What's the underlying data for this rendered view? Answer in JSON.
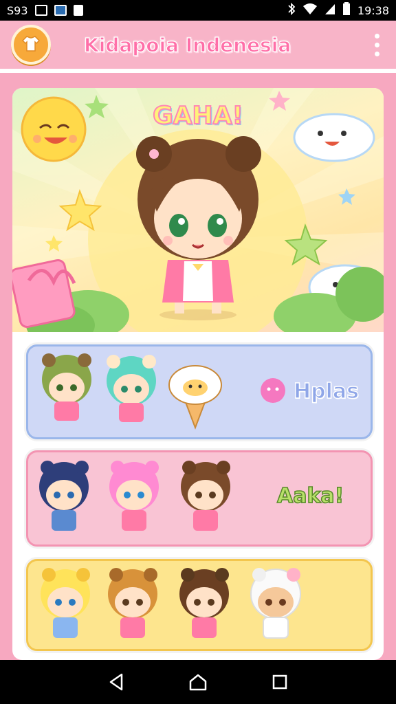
{
  "status_bar": {
    "left_text": "S93",
    "time": "19:38"
  },
  "app_bar": {
    "title": "Kidapoia Indenesia",
    "logo_icon": "shirt-icon",
    "menu_icon": "more-vert-icon"
  },
  "hero": {
    "title": "GAHA!"
  },
  "cards": [
    {
      "label": "Hplas",
      "color": "#cfd8f6",
      "label_color": "#8fa6e8"
    },
    {
      "label": "Aaka!",
      "color": "#f9c4d4",
      "label_color": "#b8e06a"
    },
    {
      "label": "",
      "color": "#fde58e"
    }
  ],
  "nav": {
    "back_icon": "back-triangle-icon",
    "home_icon": "home-icon",
    "recents_icon": "recents-square-icon"
  },
  "colors": {
    "primary_pink": "#f8b4c8",
    "accent_pink": "#ff6fa8",
    "orange": "#f7a93a"
  }
}
